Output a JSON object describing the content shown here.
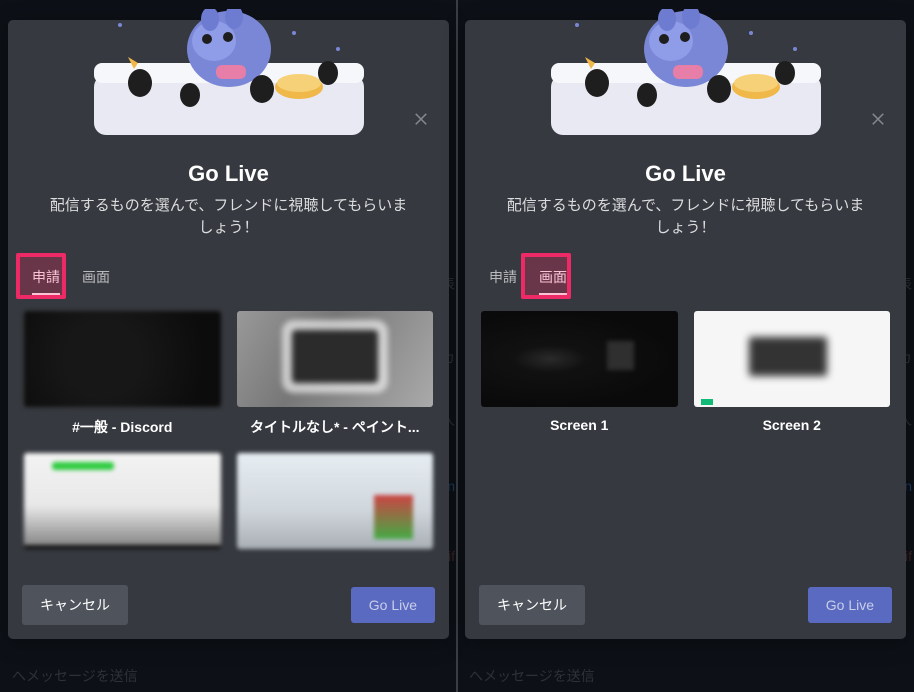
{
  "left": {
    "title": "Go Live",
    "subtitle": "配信するものを選んで、フレンドに視聴してもらいましょう！",
    "tabs": {
      "apps": "申請",
      "screens": "画面",
      "active": "apps"
    },
    "sources": [
      {
        "label": "#一般 - Discord"
      },
      {
        "label": "タイトルなし* - ペイント..."
      }
    ],
    "buttons": {
      "cancel": "キャンセル",
      "go_live": "Go Live"
    }
  },
  "right": {
    "title": "Go Live",
    "subtitle": "配信するものを選んで、フレンドに視聴してもらいましょう！",
    "tabs": {
      "apps": "申請",
      "screens": "画面",
      "active": "screens"
    },
    "sources": [
      {
        "label": "Screen 1"
      },
      {
        "label": "Screen 2"
      }
    ],
    "buttons": {
      "cancel": "キャンセル",
      "go_live": "Go Live"
    }
  },
  "background": {
    "right_edge_1": "由表",
    "right_edge_2": "をカ",
    "right_edge_3": "友人",
    "right_edge_4": "on",
    "right_edge_5": "d if",
    "bottom": "へメッセージを送信"
  }
}
